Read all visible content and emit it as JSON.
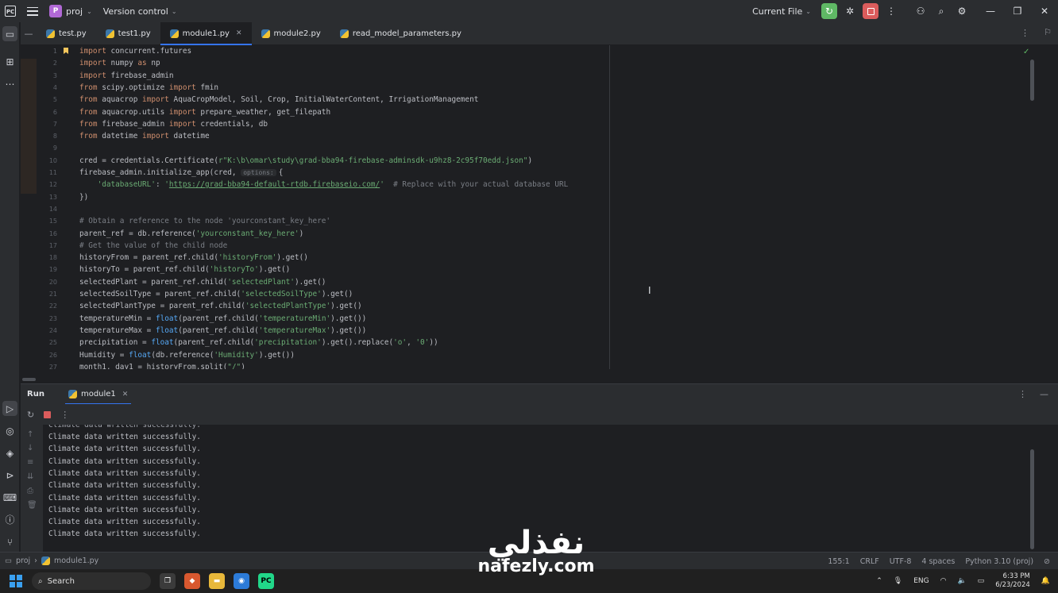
{
  "titlebar": {
    "project_badge": "P",
    "project_name": "proj",
    "version_control": "Version control",
    "run_config": "Current File"
  },
  "tabs": [
    {
      "label": "test.py",
      "active": false
    },
    {
      "label": "test1.py",
      "active": false
    },
    {
      "label": "module1.py",
      "active": true
    },
    {
      "label": "module2.py",
      "active": false
    },
    {
      "label": "read_model_parameters.py",
      "active": false
    }
  ],
  "editor": {
    "lines": [
      [
        {
          "t": "import",
          "c": "kw"
        },
        {
          "t": " concurrent.futures"
        }
      ],
      [
        {
          "t": "import",
          "c": "kw"
        },
        {
          "t": " numpy "
        },
        {
          "t": "as",
          "c": "kw"
        },
        {
          "t": " np"
        }
      ],
      [
        {
          "t": "import",
          "c": "kw"
        },
        {
          "t": " firebase_admin"
        }
      ],
      [
        {
          "t": "from",
          "c": "kw"
        },
        {
          "t": " scipy.optimize "
        },
        {
          "t": "import",
          "c": "kw"
        },
        {
          "t": " fmin"
        }
      ],
      [
        {
          "t": "from",
          "c": "kw"
        },
        {
          "t": " aquacrop "
        },
        {
          "t": "import",
          "c": "kw"
        },
        {
          "t": " AquaCropModel, Soil, Crop, InitialWaterContent, IrrigationManagement"
        }
      ],
      [
        {
          "t": "from",
          "c": "kw"
        },
        {
          "t": " aquacrop.utils "
        },
        {
          "t": "import",
          "c": "kw"
        },
        {
          "t": " prepare_weather, get_filepath"
        }
      ],
      [
        {
          "t": "from",
          "c": "kw"
        },
        {
          "t": " firebase_admin "
        },
        {
          "t": "import",
          "c": "kw"
        },
        {
          "t": " credentials, db"
        }
      ],
      [
        {
          "t": "from",
          "c": "kw"
        },
        {
          "t": " datetime "
        },
        {
          "t": "import",
          "c": "kw"
        },
        {
          "t": " datetime"
        }
      ],
      [],
      [
        {
          "t": "cred = credentials.Certificate("
        },
        {
          "t": "r\"K:\\b\\omar\\study\\grad-bba94-firebase-adminsdk-u9hz8-2c95f70edd.json\"",
          "c": "str"
        },
        {
          "t": ")"
        }
      ],
      [
        {
          "t": "firebase_admin.initialize_app(cred, "
        },
        {
          "t": "options:",
          "c": "hint"
        },
        {
          "t": "{"
        }
      ],
      [
        {
          "t": "    "
        },
        {
          "t": "'databaseURL'",
          "c": "str"
        },
        {
          "t": ": "
        },
        {
          "t": "'",
          "c": "str"
        },
        {
          "t": "https://grad-bba94-default-rtdb.firebaseio.com/",
          "c": "lnk"
        },
        {
          "t": "'",
          "c": "str"
        },
        {
          "t": "  "
        },
        {
          "t": "# Replace with your actual database URL",
          "c": "cm"
        }
      ],
      [
        {
          "t": "})"
        }
      ],
      [],
      [
        {
          "t": "# Obtain a reference to the node 'yourconstant_key_here'",
          "c": "cm"
        }
      ],
      [
        {
          "t": "parent_ref = db.reference("
        },
        {
          "t": "'yourconstant_key_here'",
          "c": "str"
        },
        {
          "t": ")"
        }
      ],
      [
        {
          "t": "# Get the value of the child node",
          "c": "cm"
        }
      ],
      [
        {
          "t": "historyFrom = parent_ref.child("
        },
        {
          "t": "'historyFrom'",
          "c": "str"
        },
        {
          "t": ").get()"
        }
      ],
      [
        {
          "t": "historyTo = parent_ref.child("
        },
        {
          "t": "'historyTo'",
          "c": "str"
        },
        {
          "t": ").get()"
        }
      ],
      [
        {
          "t": "selectedPlant = parent_ref.child("
        },
        {
          "t": "'selectedPlant'",
          "c": "str"
        },
        {
          "t": ").get()"
        }
      ],
      [
        {
          "t": "selectedSoilType = parent_ref.child("
        },
        {
          "t": "'selectedSoilType'",
          "c": "str"
        },
        {
          "t": ").get()"
        }
      ],
      [
        {
          "t": "selectedPlantType = parent_ref.child("
        },
        {
          "t": "'selectedPlantType'",
          "c": "str"
        },
        {
          "t": ").get()"
        }
      ],
      [
        {
          "t": "temperatureMin = "
        },
        {
          "t": "float",
          "c": "fn"
        },
        {
          "t": "(parent_ref.child("
        },
        {
          "t": "'temperatureMin'",
          "c": "str"
        },
        {
          "t": ").get())"
        }
      ],
      [
        {
          "t": "temperatureMax = "
        },
        {
          "t": "float",
          "c": "fn"
        },
        {
          "t": "(parent_ref.child("
        },
        {
          "t": "'temperatureMax'",
          "c": "str"
        },
        {
          "t": ").get())"
        }
      ],
      [
        {
          "t": "precipitation = "
        },
        {
          "t": "float",
          "c": "fn"
        },
        {
          "t": "(parent_ref.child("
        },
        {
          "t": "'precipitation'",
          "c": "str"
        },
        {
          "t": ").get().replace("
        },
        {
          "t": "'o'",
          "c": "str"
        },
        {
          "t": ", "
        },
        {
          "t": "'0'",
          "c": "str"
        },
        {
          "t": "))"
        }
      ],
      [
        {
          "t": "Humidity = "
        },
        {
          "t": "float",
          "c": "fn"
        },
        {
          "t": "(db.reference("
        },
        {
          "t": "'Humidity'",
          "c": "str"
        },
        {
          "t": ").get())"
        }
      ],
      [
        {
          "t": "month1, day1 = historyFrom.split("
        },
        {
          "t": "\"/\"",
          "c": "str"
        },
        {
          "t": ")"
        }
      ]
    ]
  },
  "run_panel": {
    "title": "Run",
    "tab_label": "module1",
    "output_lines": [
      "Climate data written successfully.",
      "Climate data written successfully.",
      "Climate data written successfully.",
      "Climate data written successfully.",
      "Climate data written successfully.",
      "Climate data written successfully.",
      "Climate data written successfully.",
      "Climate data written successfully.",
      "Climate data written successfully.",
      "Climate data written successfully.",
      "Climate data written successfully."
    ]
  },
  "statusbar": {
    "project": "proj",
    "file": "module1.py",
    "position": "155:1",
    "line_sep": "CRLF",
    "encoding": "UTF-8",
    "indent": "4 spaces",
    "interpreter": "Python 3.10 (proj)"
  },
  "taskbar": {
    "search": "Search",
    "lang": "ENG",
    "time": "6:33 PM",
    "date": "6/23/2024"
  },
  "watermark": {
    "arabic": "نفذلي",
    "latin": "nafezly.com"
  },
  "colors": {
    "accent": "#3574f0",
    "keyword": "#cf8e6d",
    "string": "#6aab73",
    "comment": "#7a7e85",
    "run_green": "#5fb865",
    "stop_red": "#db5c5c"
  }
}
